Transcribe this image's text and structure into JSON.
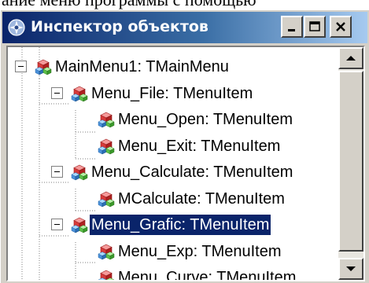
{
  "background_text": "ание меню программы с помощью",
  "window": {
    "title": "Инспектор объектов",
    "icon": "object-inspector-icon",
    "buttons": [
      "minimize-icon",
      "maximize-icon",
      "close-icon"
    ]
  },
  "tree": {
    "items": [
      {
        "label": "MainMenu1: TMainMenu",
        "level": 0,
        "expanded": true,
        "selected": false
      },
      {
        "label": "Menu_File: TMenuItem",
        "level": 1,
        "expanded": true,
        "selected": false
      },
      {
        "label": "Menu_Open: TMenuItem",
        "level": 2,
        "expanded": false,
        "selected": false
      },
      {
        "label": "Menu_Exit: TMenuItem",
        "level": 2,
        "expanded": false,
        "selected": false
      },
      {
        "label": "Menu_Calculate: TMenuItem",
        "level": 1,
        "expanded": true,
        "selected": false
      },
      {
        "label": "MCalculate: TMenuItem",
        "level": 2,
        "expanded": false,
        "selected": false
      },
      {
        "label": "Menu_Grafic: TMenuItem",
        "level": 1,
        "expanded": true,
        "selected": true
      },
      {
        "label": "Menu_Exp: TMenuItem",
        "level": 2,
        "expanded": false,
        "selected": false
      },
      {
        "label": "Menu_Curve: TMenuItem",
        "level": 2,
        "expanded": false,
        "selected": false
      }
    ],
    "icon": "component-cubes-icon"
  },
  "scrollbar": {
    "up": "arrow-up-icon",
    "down": "arrow-down-icon"
  },
  "colors": {
    "title_start": "#0a246a",
    "title_end": "#a6caf0",
    "selection": "#0a246a",
    "face": "#d4d0c8"
  }
}
